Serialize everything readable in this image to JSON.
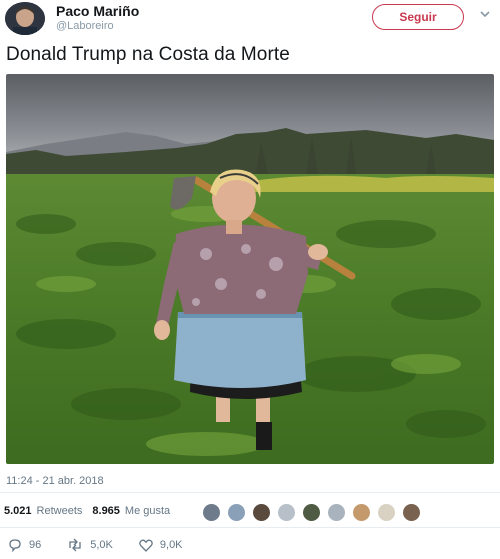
{
  "tweet": {
    "display_name": "Paco Mariño",
    "handle": "@Laboreiro",
    "follow_label": "Seguir",
    "text": "Donald Trump na Costa da Morte",
    "timestamp": "11:24 - 21 abr. 2018"
  },
  "stats": {
    "retweets_count": "5.021",
    "retweets_label": "Retweets",
    "likes_count": "8.965",
    "likes_label": "Me gusta"
  },
  "likers": [
    "#6d7b8a",
    "#8aa0b8",
    "#5a4a3e",
    "#b7c0c9",
    "#4f5b43",
    "#a8b3bd",
    "#c49a6c",
    "#d9d2c2",
    "#7a6250"
  ],
  "actions": {
    "reply_count": "96",
    "retweet_count": "5,0K",
    "like_count": "9,0K"
  },
  "icons": {
    "chevron": "chevron-down-icon",
    "reply": "reply-icon",
    "retweet": "retweet-icon",
    "like": "heart-icon"
  }
}
